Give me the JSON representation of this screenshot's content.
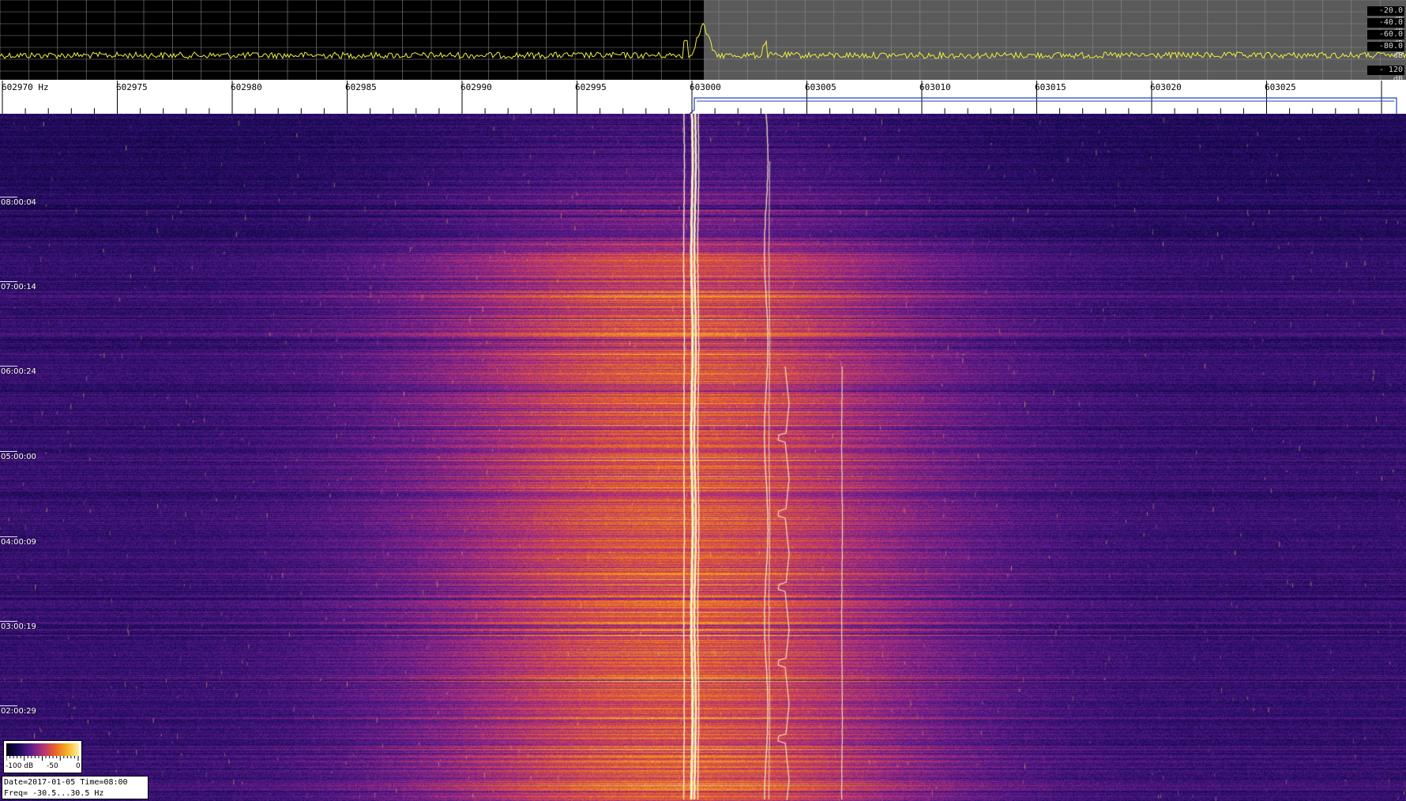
{
  "spectrum": {
    "db_scale": [
      "-20.0 dB",
      "-40.0 dB",
      "-60.0 dB",
      "-80.0 dB",
      "- 120 dB"
    ],
    "colors": {
      "left_background": "#000000",
      "right_background": "#5a5a5a",
      "grid": "#8a8a8a",
      "trace": "#f0f040"
    }
  },
  "frequency_axis": {
    "labels": [
      "602970 Hz",
      "602975",
      "602980",
      "602985",
      "602990",
      "602995",
      "603000",
      "603005",
      "603010",
      "603015",
      "603020",
      "603025"
    ],
    "marker_color": "#2040c0"
  },
  "waterfall": {
    "time_labels": [
      "08:00:04",
      "07:00:14",
      "06:00:24",
      "05:00:00",
      "04:00:09",
      "03:00:19",
      "02:00:29"
    ],
    "colormap": [
      "#000010",
      "#1a0a5a",
      "#5a1a8a",
      "#b0307a",
      "#e8602a",
      "#f8b020",
      "#fff2a0"
    ]
  },
  "colorbar": {
    "labels": [
      "-100 dB",
      "-50",
      "0"
    ]
  },
  "info": {
    "line1": "Date=2017-01-05 Time=08:00",
    "line2": "Freq= -30.5...30.5 Hz"
  }
}
